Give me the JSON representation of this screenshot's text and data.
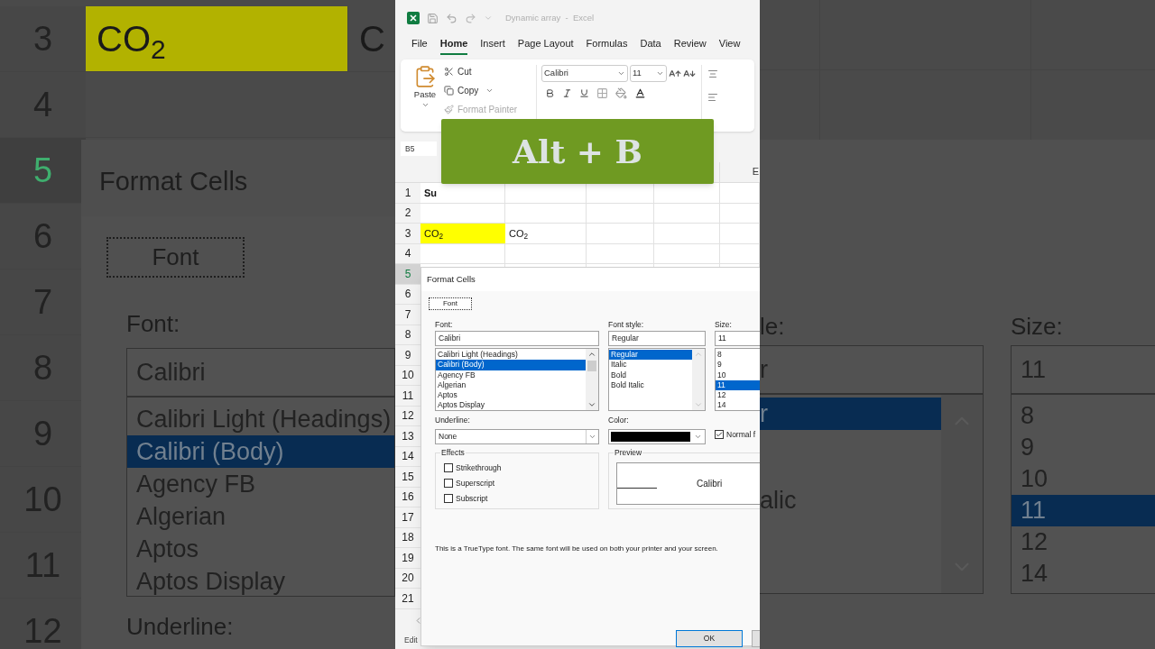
{
  "left_backdrop": {
    "row_numbers": [
      {
        "label": "3",
        "selected": false
      },
      {
        "label": "4",
        "selected": false
      },
      {
        "label": "5",
        "selected": true
      },
      {
        "label": "6",
        "selected": false
      },
      {
        "label": "7",
        "selected": false
      },
      {
        "label": "8",
        "selected": false
      },
      {
        "label": "9",
        "selected": false
      },
      {
        "label": "10",
        "selected": false
      },
      {
        "label": "11",
        "selected": false
      },
      {
        "label": "12",
        "selected": false
      }
    ],
    "cells": [
      {
        "text": "CO$_{2}$",
        "highlight": true
      },
      {
        "text": "C",
        "highlight": false
      }
    ],
    "dialog": {
      "title": "Format Cells",
      "tab": {
        "label": "Font",
        "selected": true
      },
      "font_label": "Font:",
      "font_value": "Calibri",
      "font_list": [
        {
          "label": "Calibri Light (Headings)",
          "selected": false
        },
        {
          "label": "Calibri (Body)",
          "selected": true
        },
        {
          "label": "Agency FB",
          "selected": false
        },
        {
          "label": "Algerian",
          "selected": false
        },
        {
          "label": "Aptos",
          "selected": false
        },
        {
          "label": "Aptos Display",
          "selected": false
        }
      ],
      "underline_label": "Underline:"
    }
  },
  "window": {
    "title": "Dynamic array  -  Excel"
  },
  "menu": [
    {
      "label": "File",
      "selected": false
    },
    {
      "label": "Home",
      "selected": true
    },
    {
      "label": "Insert",
      "selected": false
    },
    {
      "label": "Page Layout",
      "selected": false
    },
    {
      "label": "Formulas",
      "selected": false
    },
    {
      "label": "Data",
      "selected": false
    },
    {
      "label": "Review",
      "selected": false
    },
    {
      "label": "View",
      "selected": false
    }
  ],
  "ribbon": {
    "paste": "Paste",
    "cut": "Cut",
    "copy": "Copy",
    "format_painter": {
      "label": "Format Painter",
      "disabled": true
    },
    "font_name": "Calibri",
    "font_size": "11"
  },
  "name_box": "B5",
  "sheet": {
    "column_header": "E",
    "rows": [
      {
        "number": "1",
        "selected": false,
        "cells": [
          {
            "text": "Su",
            "bold": true,
            "highlight": false
          }
        ]
      },
      {
        "number": "2",
        "selected": false
      },
      {
        "number": "3",
        "selected": false,
        "cells": [
          {
            "text": "CO$_{2}$",
            "bold": false,
            "highlight": true
          },
          {
            "text": "CO$_{2}$",
            "bold": false,
            "highlight": false
          }
        ]
      },
      {
        "number": "4",
        "selected": false
      },
      {
        "number": "5",
        "selected": true
      },
      {
        "number": "6",
        "selected": false
      },
      {
        "number": "7",
        "selected": false
      },
      {
        "number": "8",
        "selected": false
      },
      {
        "number": "9",
        "selected": false
      },
      {
        "number": "10",
        "selected": false
      },
      {
        "number": "11",
        "selected": false
      },
      {
        "number": "12",
        "selected": false
      },
      {
        "number": "13",
        "selected": false
      },
      {
        "number": "14",
        "selected": false
      },
      {
        "number": "15",
        "selected": false
      },
      {
        "number": "16",
        "selected": false
      },
      {
        "number": "17",
        "selected": false
      },
      {
        "number": "18",
        "selected": false
      },
      {
        "number": "19",
        "selected": false
      },
      {
        "number": "20",
        "selected": false
      },
      {
        "number": "21",
        "selected": false
      }
    ]
  },
  "overlay": {
    "text": "Alt + B"
  },
  "dialog": {
    "title": "Format Cells",
    "tabs": [
      {
        "label": "Font",
        "selected": true
      }
    ],
    "font": {
      "label": "Font:",
      "value": "Calibri",
      "options": [
        {
          "label": "Calibri Light (Headings)",
          "selected": false
        },
        {
          "label": "Calibri (Body)",
          "selected": true
        },
        {
          "label": "Agency FB",
          "selected": false
        },
        {
          "label": "Algerian",
          "selected": false
        },
        {
          "label": "Aptos",
          "selected": false
        },
        {
          "label": "Aptos Display",
          "selected": false
        }
      ]
    },
    "font_style": {
      "label": "Font style:",
      "value": "Regular",
      "options": [
        {
          "label": "Regular",
          "selected": true
        },
        {
          "label": "Italic",
          "selected": false
        },
        {
          "label": "Bold",
          "selected": false
        },
        {
          "label": "Bold Italic",
          "selected": false
        }
      ]
    },
    "size": {
      "label": "Size:",
      "value": "11",
      "options": [
        {
          "label": "8",
          "selected": false
        },
        {
          "label": "9",
          "selected": false
        },
        {
          "label": "10",
          "selected": false
        },
        {
          "label": "11",
          "selected": true
        },
        {
          "label": "12",
          "selected": false
        },
        {
          "label": "14",
          "selected": false
        }
      ]
    },
    "underline": {
      "label": "Underline:",
      "value": "None"
    },
    "color": {
      "label": "Color:",
      "color": "#000000"
    },
    "normal_font": {
      "label": "Normal f",
      "checked": true
    },
    "effects": {
      "title": "Effects",
      "options": [
        {
          "label": "Strikethrough",
          "checked": false
        },
        {
          "label": "Superscript",
          "checked": false
        },
        {
          "label": "Subscript",
          "checked": false
        }
      ]
    },
    "preview": {
      "title": "Preview",
      "sample": "Calibri"
    },
    "note": "This is a TrueType font.  The same font will be used on both your printer and your screen.",
    "buttons": [
      "OK"
    ]
  },
  "status_bar": {
    "mode": "Edit"
  },
  "right_backdrop": {
    "style_label": "le:",
    "style_value": "r",
    "style_list": [
      {
        "label": "r",
        "selected": true
      },
      {
        "label": "alic",
        "selected": false
      }
    ],
    "size_label": "Size:",
    "size_value": "11",
    "size_list": [
      {
        "label": "8",
        "selected": false
      },
      {
        "label": "9",
        "selected": false
      },
      {
        "label": "10",
        "selected": false
      },
      {
        "label": "11",
        "selected": true
      },
      {
        "label": "12",
        "selected": false
      },
      {
        "label": "14",
        "selected": false
      }
    ]
  }
}
